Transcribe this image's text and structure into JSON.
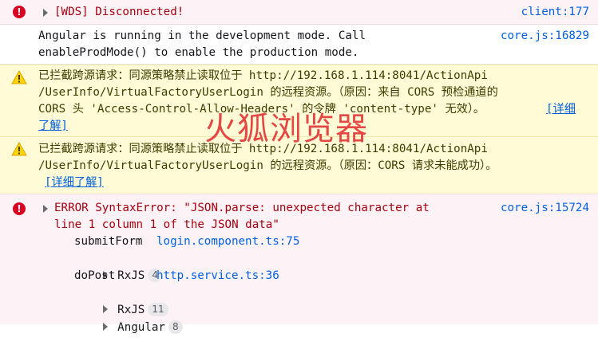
{
  "messages": {
    "wds": {
      "text": "[WDS] Disconnected!",
      "source": "client:177"
    },
    "angular": {
      "line1": "Angular is running in the development mode. Call",
      "line2": "enableProdMode() to enable the production mode.",
      "source": "core.js:16829"
    },
    "cors1": {
      "line1": "已拦截跨源请求：同源策略禁止读取位于 http://192.168.1.114:8041/ActionApi",
      "line2": "/UserInfo/VirtualFactoryUserLogin 的远程资源。（原因：来自 CORS 预检通道的",
      "line3": "CORS 头 'Access-Control-Allow-Headers' 的令牌 'content-type' 无效）。",
      "link_a": "[详细",
      "link_b": "了解]"
    },
    "cors2": {
      "line1": "已拦截跨源请求：同源策略禁止读取位于 http://192.168.1.114:8041/ActionApi",
      "line2": "/UserInfo/VirtualFactoryUserLogin 的远程资源。（原因：CORS 请求未能成功）。",
      "link": "[详细了解]"
    },
    "syntax": {
      "line1": "ERROR SyntaxError: \"JSON.parse: unexpected character at",
      "line2": "line 1 column 1 of the JSON data\"",
      "source": "core.js:15724",
      "stack": [
        {
          "fn": "submitForm",
          "file": "login.component.ts:75"
        },
        {
          "group": "RxJS",
          "count": "4"
        },
        {
          "fn": "doPost",
          "file": "http.service.ts:36"
        },
        {
          "group": "RxJS",
          "count": "11"
        },
        {
          "group": "Angular",
          "count": "8"
        }
      ]
    }
  },
  "watermark": "火狐浏览器"
}
